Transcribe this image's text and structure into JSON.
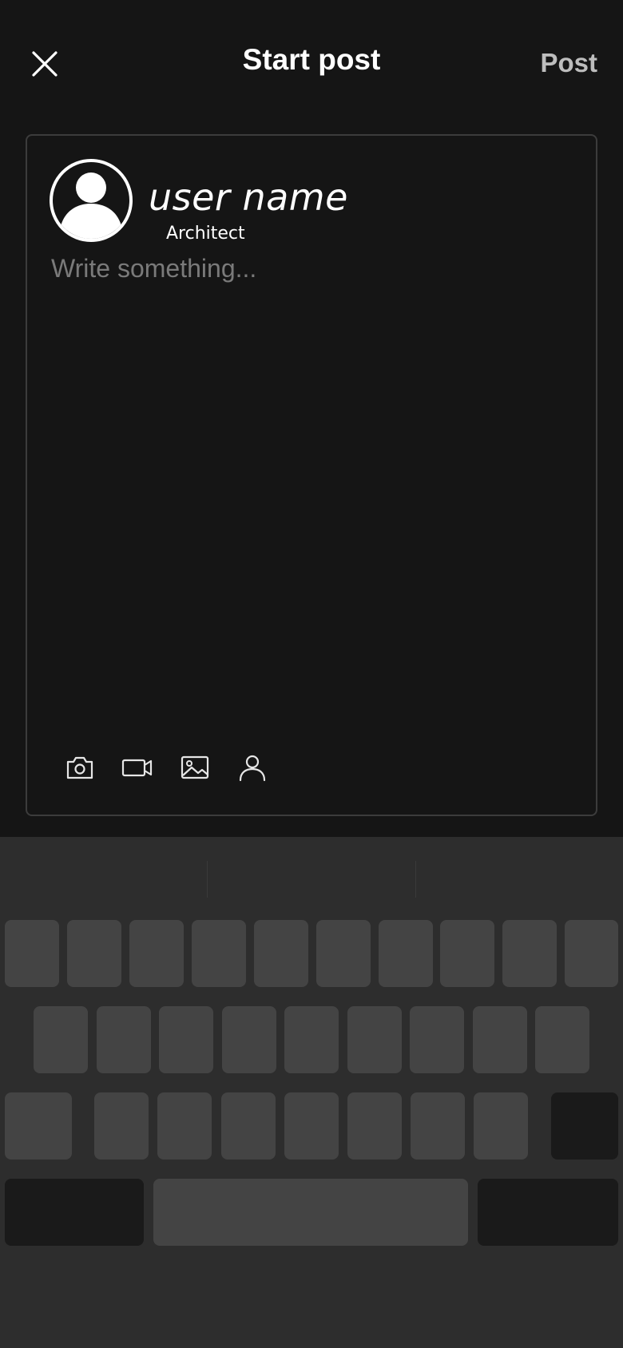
{
  "header": {
    "title": "Start post",
    "post_label": "Post"
  },
  "composer": {
    "user_name": "user name",
    "user_role": "Architect",
    "placeholder": "Write something...",
    "value": ""
  },
  "attachments": [
    {
      "icon": "camera-icon"
    },
    {
      "icon": "video-icon"
    },
    {
      "icon": "image-icon"
    },
    {
      "icon": "tag-person-icon"
    }
  ],
  "keyboard": {
    "row1_keys": 10,
    "row2_keys": 9,
    "row3_keys": 7
  },
  "colors": {
    "background": "#151515",
    "keyboard_bg": "#2d2d2d",
    "key": "#444444",
    "key_dark": "#1a1a1a",
    "post_label": "#bdbdbd",
    "placeholder": "#7a7a7a"
  }
}
